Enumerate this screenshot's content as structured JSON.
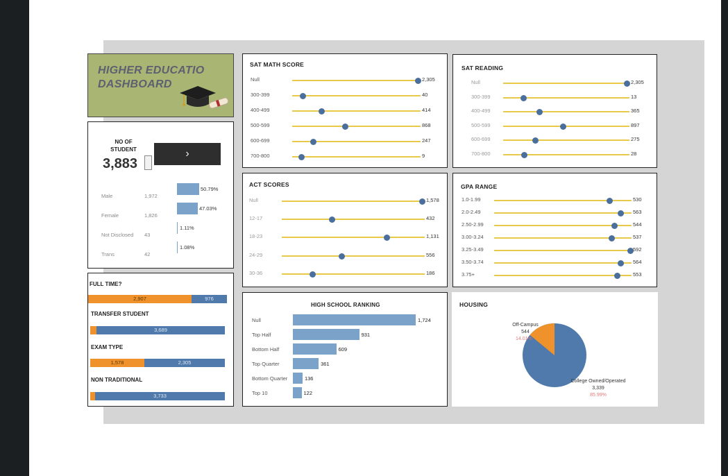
{
  "title": {
    "line1": "HIGHER EDUCATIO",
    "line2": "DASHBOARD"
  },
  "students": {
    "heading_line1": "NO OF",
    "heading_line2": "STUDENT",
    "count": "3,883",
    "next_symbol": "›",
    "genders": [
      {
        "label": "Male",
        "value": "1,972",
        "pct": "50.79%",
        "fraction": 0.5079
      },
      {
        "label": "Female",
        "value": "1,826",
        "pct": "47.03%",
        "fraction": 0.4703
      },
      {
        "label": "Not Disclosed",
        "value": "43",
        "pct": "1.11%",
        "fraction": 0.0111
      },
      {
        "label": "Trans",
        "value": "42",
        "pct": "1.08%",
        "fraction": 0.0108
      }
    ]
  },
  "full_time": {
    "title": "FULL TIME?",
    "orange": "2,907",
    "blue": "976"
  },
  "transfer": {
    "title": "TRANSFER STUDENT",
    "orange": "",
    "blue": "3,689"
  },
  "exam_type": {
    "title": "EXAM TYPE",
    "orange": "1,578",
    "blue": "2,305"
  },
  "non_traditional": {
    "title": "NON TRADITIONAL",
    "orange": "",
    "blue": "3,733"
  },
  "sat_math": {
    "title": "SAT MATH SCORE",
    "rows": [
      {
        "label": "Null",
        "value": "2,305"
      },
      {
        "label": "300-399",
        "value": "40"
      },
      {
        "label": "400-499",
        "value": "414"
      },
      {
        "label": "500-599",
        "value": "868"
      },
      {
        "label": "600-699",
        "value": "247"
      },
      {
        "label": "700-800",
        "value": "9"
      }
    ]
  },
  "sat_reading": {
    "title": "SAT READING",
    "rows": [
      {
        "label": "Null",
        "value": "2,305"
      },
      {
        "label": "300-399",
        "value": "13"
      },
      {
        "label": "400-499",
        "value": "365"
      },
      {
        "label": "500-599",
        "value": "897"
      },
      {
        "label": "600-699",
        "value": "275"
      },
      {
        "label": "700-800",
        "value": "28"
      }
    ]
  },
  "act": {
    "title": "ACT SCORES",
    "rows": [
      {
        "label": "Null",
        "value": "1,578"
      },
      {
        "label": "12-17",
        "value": "432"
      },
      {
        "label": "18-23",
        "value": "1,131"
      },
      {
        "label": "24-29",
        "value": "556"
      },
      {
        "label": "30-36",
        "value": "186"
      }
    ]
  },
  "gpa": {
    "title": "GPA RANGE",
    "rows": [
      {
        "label": "1.0-1.99",
        "value": "530"
      },
      {
        "label": "2.0-2.49",
        "value": "563"
      },
      {
        "label": "2.50-2.99",
        "value": "544"
      },
      {
        "label": "3.00-3.24",
        "value": "537"
      },
      {
        "label": "3.25-3.49",
        "value": "592"
      },
      {
        "label": "3.50-3.74",
        "value": "564"
      },
      {
        "label": "3.75+",
        "value": "553"
      }
    ]
  },
  "hs_ranking": {
    "title": "HIGH SCHOOL RANKING",
    "rows": [
      {
        "label": "Null",
        "value": "1,724"
      },
      {
        "label": "Top Half",
        "value": "931"
      },
      {
        "label": "Bottom Half",
        "value": "609"
      },
      {
        "label": "Top Quarter",
        "value": "361"
      },
      {
        "label": "Bottom Quarter",
        "value": "136"
      },
      {
        "label": "Top 10",
        "value": "122"
      }
    ]
  },
  "housing": {
    "title": "HOUSING",
    "slices": [
      {
        "label": "Off-Campus",
        "value": "544",
        "pct": "14.01%"
      },
      {
        "label": "College Owned/Operated",
        "value": "3,339",
        "pct": "85.99%"
      }
    ]
  },
  "colors": {
    "orange": "#f0922b",
    "blue": "#4f7aab",
    "bar": "#7ba3c9",
    "line": "#e8c949",
    "dot": "#4a6f9c",
    "title_bg": "#a8b573"
  }
}
